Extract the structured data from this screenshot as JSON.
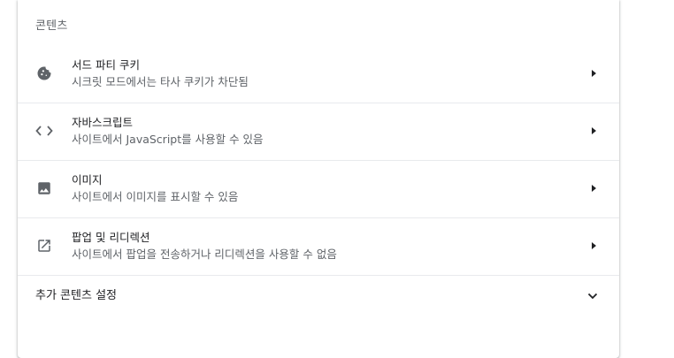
{
  "section": {
    "title": "콘텐츠"
  },
  "rows": [
    {
      "label": "서드 파티 쿠키",
      "sub": "시크릿 모드에서는 타사 쿠키가 차단됨",
      "icon": "cookie-icon"
    },
    {
      "label": "자바스크립트",
      "sub": "사이트에서 JavaScript를 사용할 수 있음",
      "icon": "code-icon"
    },
    {
      "label": "이미지",
      "sub": "사이트에서 이미지를 표시할 수 있음",
      "icon": "image-icon"
    },
    {
      "label": "팝업 및 리디렉션",
      "sub": "사이트에서 팝업을 전송하거나 리디렉션을 사용할 수 없음",
      "icon": "open-in-new-icon"
    }
  ],
  "more": {
    "label": "추가 콘텐츠 설정",
    "icon": "chevron-down-icon"
  },
  "colors": {
    "text_primary": "#202124",
    "text_secondary": "#5f6368",
    "divider": "#e8eaed",
    "icon": "#5f6368"
  }
}
